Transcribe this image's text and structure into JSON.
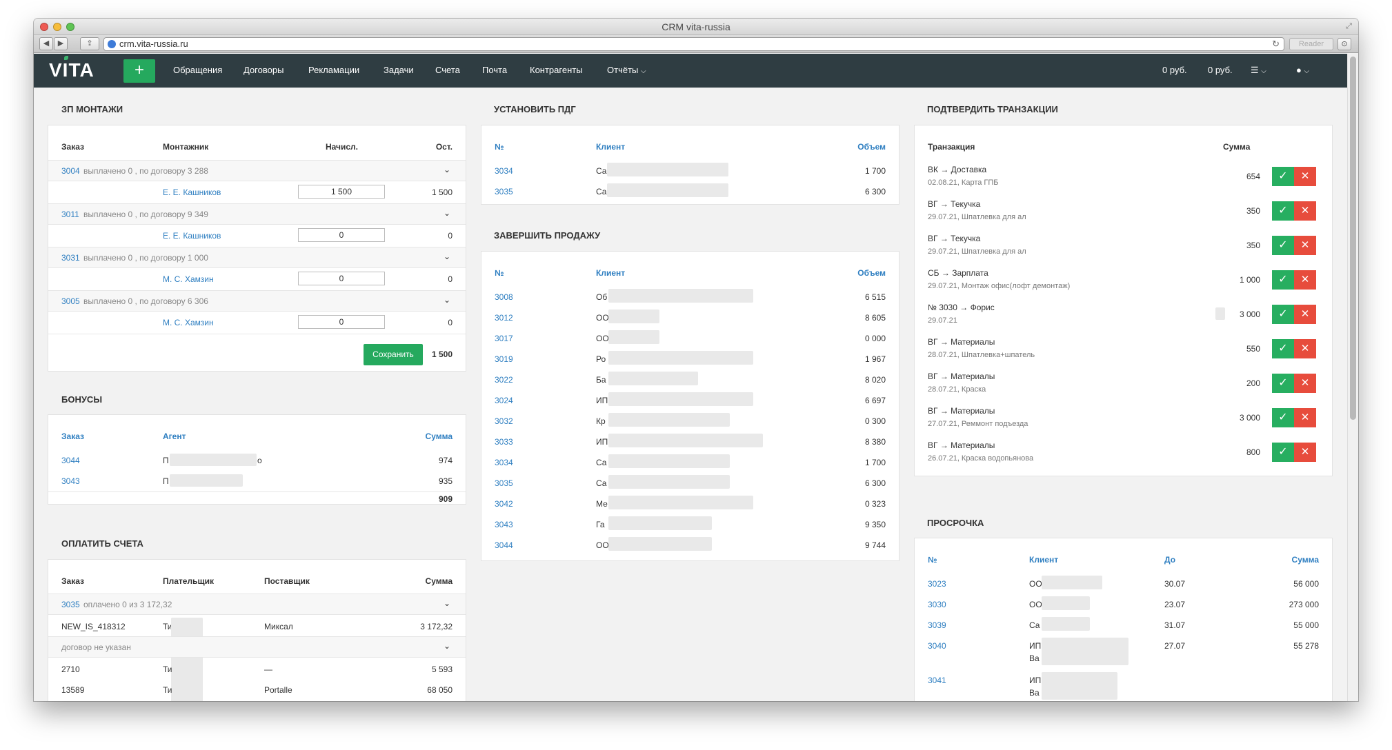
{
  "window": {
    "title": "CRM vita-russia",
    "url": "crm.vita-russia.ru",
    "reader_label": "Reader"
  },
  "navbar": {
    "logo": "VITA",
    "add_button": "+",
    "items": [
      "Обращения",
      "Договоры",
      "Рекламации",
      "Задачи",
      "Счета",
      "Почта",
      "Контрагенты",
      "Отчёты"
    ],
    "balance_1": "0 руб.",
    "balance_2": "0 руб.",
    "accent_color": "#25a95e",
    "bar_color": "#2f3d42"
  },
  "zp": {
    "title": "ЗП МОНТАЖИ",
    "headers": [
      "Заказ",
      "Монтажник",
      "Начисл.",
      "Ост."
    ],
    "groups": [
      {
        "order": "3004",
        "text": " выплачено 0 , по договору 3 288",
        "installer": "Е. Е. Кашников",
        "accrued": "1 500",
        "rest": "1 500"
      },
      {
        "order": "3011",
        "text": " выплачено 0 , по договору 9 349",
        "installer": "Е. Е. Кашников",
        "accrued": "0",
        "rest": "0"
      },
      {
        "order": "3031",
        "text": " выплачено 0 , по договору 1 000",
        "installer": "М. С. Хамзин",
        "accrued": "0",
        "rest": "0"
      },
      {
        "order": "3005",
        "text": " выплачено 0 , по договору 6 306",
        "installer": "М. С. Хамзин",
        "accrued": "0",
        "rest": "0"
      }
    ],
    "save_label": "Сохранить",
    "total": "1 500"
  },
  "bonus": {
    "title": "БОНУСЫ",
    "headers": [
      "Заказ",
      "Агент",
      "Сумма"
    ],
    "rows": [
      {
        "order": "3044",
        "agent_start": "П",
        "agent_end": "о",
        "sum": "974"
      },
      {
        "order": "3043",
        "agent_start": "П",
        "agent_end": "",
        "sum": "935"
      }
    ],
    "total": "909"
  },
  "pay": {
    "title": "ОПЛАТИТЬ СЧЕТА",
    "headers": [
      "Заказ",
      "Плательщик",
      "Поставщик",
      "Сумма"
    ],
    "group1": {
      "order": "3035",
      "text": " оплачено 0 из 3 172,32"
    },
    "row1": {
      "order": "NEW_IS_418312",
      "payer": "Ти",
      "supplier": "Миксал",
      "sum": "3 172,32"
    },
    "group2": {
      "text": "договор не указан"
    },
    "row2": {
      "order": "2710",
      "payer": "Ти",
      "supplier": "—",
      "sum": "5 593"
    },
    "row3": {
      "order": "13589",
      "payer": "Ти",
      "supplier": "Portalle",
      "sum": "68 050"
    }
  },
  "pdg": {
    "title": "УСТАНОВИТЬ ПДГ",
    "headers": [
      "№",
      "Клиент",
      "Объем"
    ],
    "rows": [
      {
        "num": "3034",
        "client": "Са",
        "vol": "1 700"
      },
      {
        "num": "3035",
        "client": "Са",
        "vol": "6 300"
      }
    ]
  },
  "sale": {
    "title": "ЗАВЕРШИТЬ ПРОДАЖУ",
    "headers": [
      "№",
      "Клиент",
      "Объем"
    ],
    "rows": [
      {
        "num": "3008",
        "client": "Об",
        "vol": "6 515"
      },
      {
        "num": "3012",
        "client": "ОО",
        "vol": "8 605"
      },
      {
        "num": "3017",
        "client": "ОО",
        "vol": "0 000"
      },
      {
        "num": "3019",
        "client": "Ро",
        "vol": "1 967"
      },
      {
        "num": "3022",
        "client": "Ба",
        "vol": "8 020"
      },
      {
        "num": "3024",
        "client": "ИП",
        "vol": "6 697"
      },
      {
        "num": "3032",
        "client": "Кр",
        "vol": "0 300"
      },
      {
        "num": "3033",
        "client": "ИП",
        "vol": "8 380"
      },
      {
        "num": "3034",
        "client": "Са",
        "vol": "1 700"
      },
      {
        "num": "3035",
        "client": "Са",
        "vol": "6 300"
      },
      {
        "num": "3042",
        "client": "Ме",
        "vol": "0 323"
      },
      {
        "num": "3043",
        "client": "Га",
        "vol": "9 350"
      },
      {
        "num": "3044",
        "client": "ОО",
        "vol": "9 744"
      }
    ]
  },
  "tx": {
    "title": "ПОДТВЕРДИТЬ ТРАНЗАКЦИИ",
    "headers": [
      "Транзакция",
      "Сумма"
    ],
    "rows": [
      {
        "title": "ВК → Доставка",
        "sub": "02.08.21, Карта ГПБ",
        "sum": "654"
      },
      {
        "title": "ВГ → Текучка",
        "sub": "29.07.21, Шпатлевка для ал",
        "sum": "350"
      },
      {
        "title": "ВГ → Текучка",
        "sub": "29.07.21, Шпатлевка для ал",
        "sum": "350"
      },
      {
        "title": "СБ → Зарплата",
        "sub": "29.07.21, Монтаж офис(лофт демонтаж)",
        "sum": "1 000"
      },
      {
        "title": "№ 3030 → Форис",
        "sub": "29.07.21",
        "sum": "3 000"
      },
      {
        "title": "ВГ → Материалы",
        "sub": "28.07.21, Шпатлевка+шпатель",
        "sum": "550"
      },
      {
        "title": "ВГ → Материалы",
        "sub": "28.07.21, Краска",
        "sum": "200"
      },
      {
        "title": "ВГ → Материалы",
        "sub": "27.07.21, Реммонт подъезда",
        "sum": "3 000"
      },
      {
        "title": "ВГ → Материалы",
        "sub": "26.07.21, Краска водопьянова",
        "sum": "800"
      }
    ],
    "ok_glyph": "✓",
    "no_glyph": "✕"
  },
  "overdue": {
    "title": "ПРОСРОЧКА",
    "headers": [
      "№",
      "Клиент",
      "До",
      "Сумма"
    ],
    "rows": [
      {
        "num": "3023",
        "client": "ОО",
        "client2": "",
        "date": "30.07",
        "sum": "56 000"
      },
      {
        "num": "3030",
        "client": "ОО",
        "client2": "",
        "date": "23.07",
        "sum": "273 000"
      },
      {
        "num": "3039",
        "client": "Са",
        "client2": "",
        "date": "31.07",
        "sum": "55 000"
      },
      {
        "num": "3040",
        "client": "ИП",
        "client2": "Ва",
        "date": "27.07",
        "sum": "55 278"
      },
      {
        "num": "3041",
        "client": "ИП",
        "client2": "Ва",
        "date": "",
        "sum": ""
      }
    ]
  }
}
